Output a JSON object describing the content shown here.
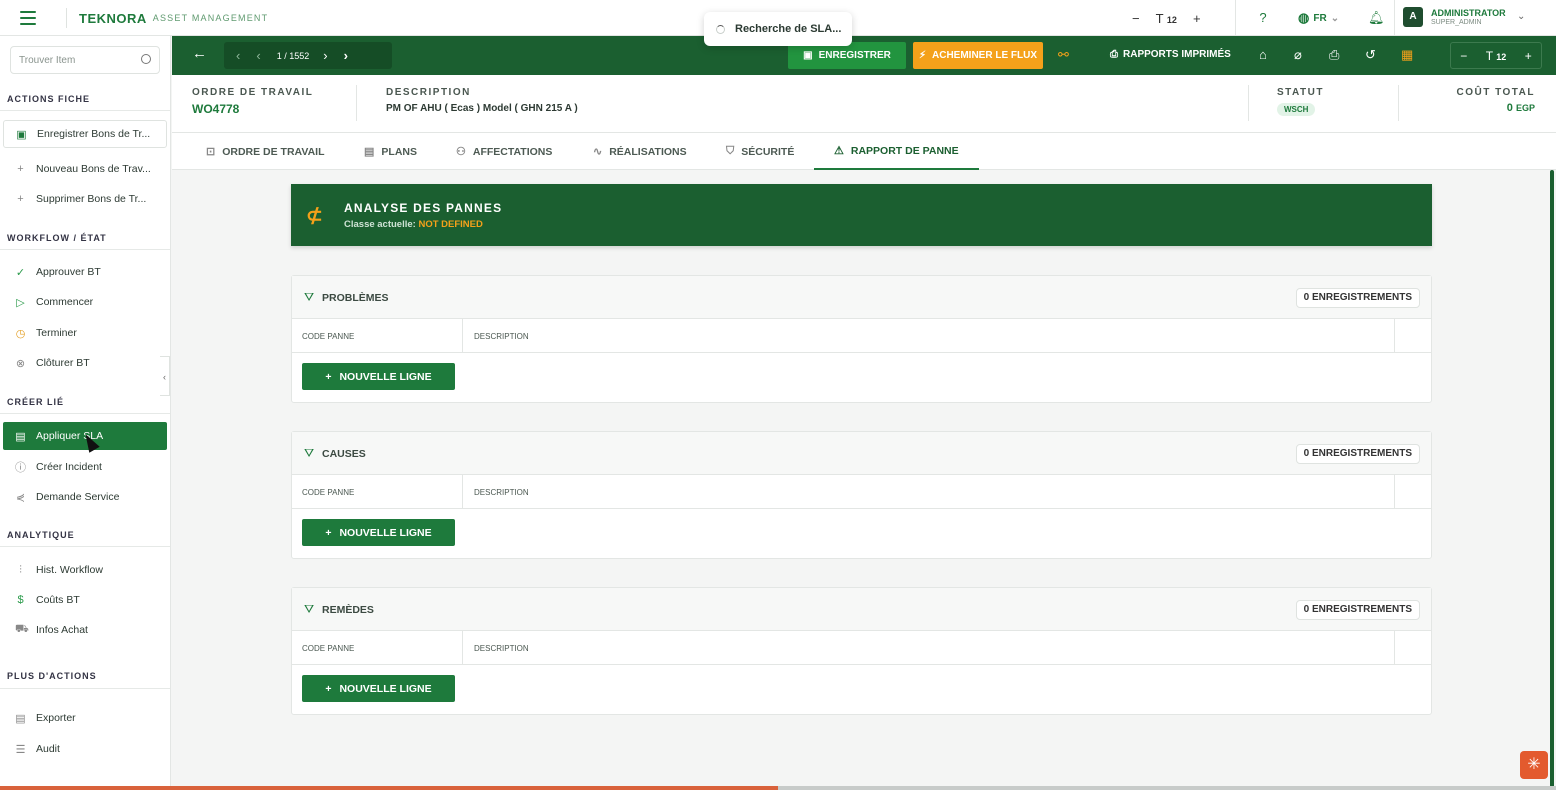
{
  "topbar": {
    "brand_name": "TEKNORA",
    "brand_sub": "ASSET MANAGEMENT",
    "font_size_value": "12",
    "lang": "FR",
    "avatar_letter": "A",
    "user_name": "ADMINISTRATOR",
    "user_role": "SUPER_ADMIN",
    "toast_text": "Recherche de SLA..."
  },
  "sidebar": {
    "search_placeholder": "Trouver Item",
    "sections": {
      "actions_fiche": "ACTIONS FICHE",
      "workflow": "WORKFLOW / ÉTAT",
      "creer_lie": "CRÉER LIÉ",
      "analytique": "ANALYTIQUE",
      "plus_actions": "PLUS D'ACTIONS"
    },
    "items": {
      "save_bt": "Enregistrer Bons de Tr...",
      "new_bt": "Nouveau Bons de Trav...",
      "delete_bt": "Supprimer Bons de Tr...",
      "approve": "Approuver BT",
      "start": "Commencer",
      "finish": "Terminer",
      "close": "Clôturer BT",
      "apply_sla": "Appliquer SLA",
      "create_incident": "Créer Incident",
      "service_request": "Demande Service",
      "wf_history": "Hist. Workflow",
      "costs": "Coûts BT",
      "purchase": "Infos Achat",
      "export": "Exporter",
      "audit": "Audit"
    }
  },
  "toolbar": {
    "pager_text": "1 / 1552",
    "save_label": "ENREGISTRER",
    "flow_label": "ACHEMINER LE FLUX",
    "reports_label": "RAPPORTS IMPRIMÉS",
    "zoom_value": "12"
  },
  "header": {
    "wo_label": "ORDRE DE TRAVAIL",
    "wo_value": "WO4778",
    "desc_label": "DESCRIPTION",
    "desc_value": "PM OF AHU   ( Ecas )  Model ( GHN 215 A )",
    "status_label": "STATUT",
    "status_value": "WSCH",
    "cost_label": "COÛT TOTAL",
    "cost_value": "0",
    "cost_currency": "EGP"
  },
  "tabs": [
    {
      "label": "ORDRE DE TRAVAIL"
    },
    {
      "label": "PLANS"
    },
    {
      "label": "AFFECTATIONS"
    },
    {
      "label": "RÉALISATIONS"
    },
    {
      "label": "SÉCURITÉ"
    },
    {
      "label": "RAPPORT DE PANNE"
    }
  ],
  "banner": {
    "title": "ANALYSE DES PANNES",
    "class_label": "Classe actuelle:",
    "class_value": "NOT DEFINED"
  },
  "panels": [
    {
      "title": "PROBLÈMES",
      "count": "0 ENREGISTREMENTS",
      "col1": "CODE PANNE",
      "col2": "DESCRIPTION",
      "add": "NOUVELLE LIGNE"
    },
    {
      "title": "CAUSES",
      "count": "0 ENREGISTREMENTS",
      "col1": "CODE PANNE",
      "col2": "DESCRIPTION",
      "add": "NOUVELLE LIGNE"
    },
    {
      "title": "REMÈDES",
      "count": "0 ENREGISTREMENTS",
      "col1": "CODE PANNE",
      "col2": "DESCRIPTION",
      "add": "NOUVELLE LIGNE"
    }
  ],
  "progress": {
    "fraction": 0.5
  },
  "colors": {
    "primary": "#1e7a3c",
    "dark": "#1b5f30",
    "accent": "#f4a11a",
    "progress": "#d9623b"
  },
  "icons": [
    "menu-icon",
    "search-icon",
    "help-icon",
    "globe-icon",
    "bell-icon",
    "save-icon",
    "bolt-icon",
    "link-icon",
    "printer-icon",
    "tag-icon",
    "paperclip-icon",
    "history-icon",
    "clipboard-icon",
    "filter-icon",
    "plus-icon",
    "fault-analysis-icon"
  ]
}
